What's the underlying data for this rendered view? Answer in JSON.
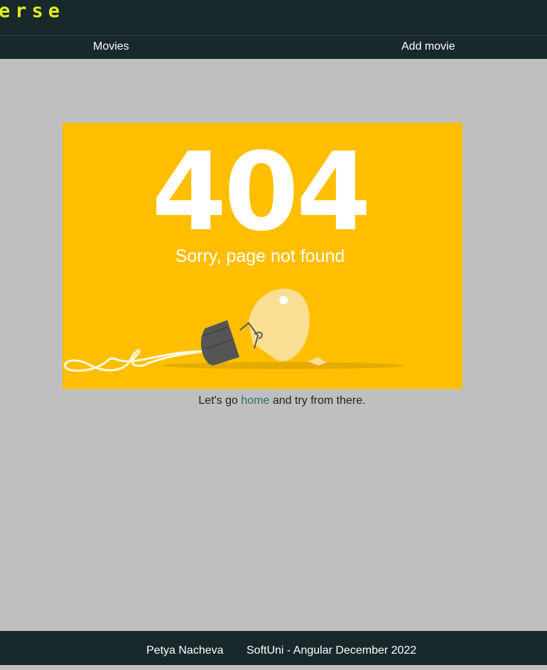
{
  "header": {
    "logo_text": "erse"
  },
  "nav": {
    "movies_label": "Movies",
    "add_movie_label": "Add movie"
  },
  "error_image": {
    "code": "404",
    "message": "Sorry, page not found",
    "background_color": "#ffbf00"
  },
  "message": {
    "prefix": "Let's go ",
    "link_text": "home",
    "suffix": " and try from there."
  },
  "footer": {
    "author": "Petya Nacheva",
    "course": "SoftUni - Angular December 2022"
  },
  "colors": {
    "header_bg": "#18292b",
    "logo": "#e1ed20",
    "page_bg": "#bfbfbf",
    "link": "#2e7066"
  }
}
